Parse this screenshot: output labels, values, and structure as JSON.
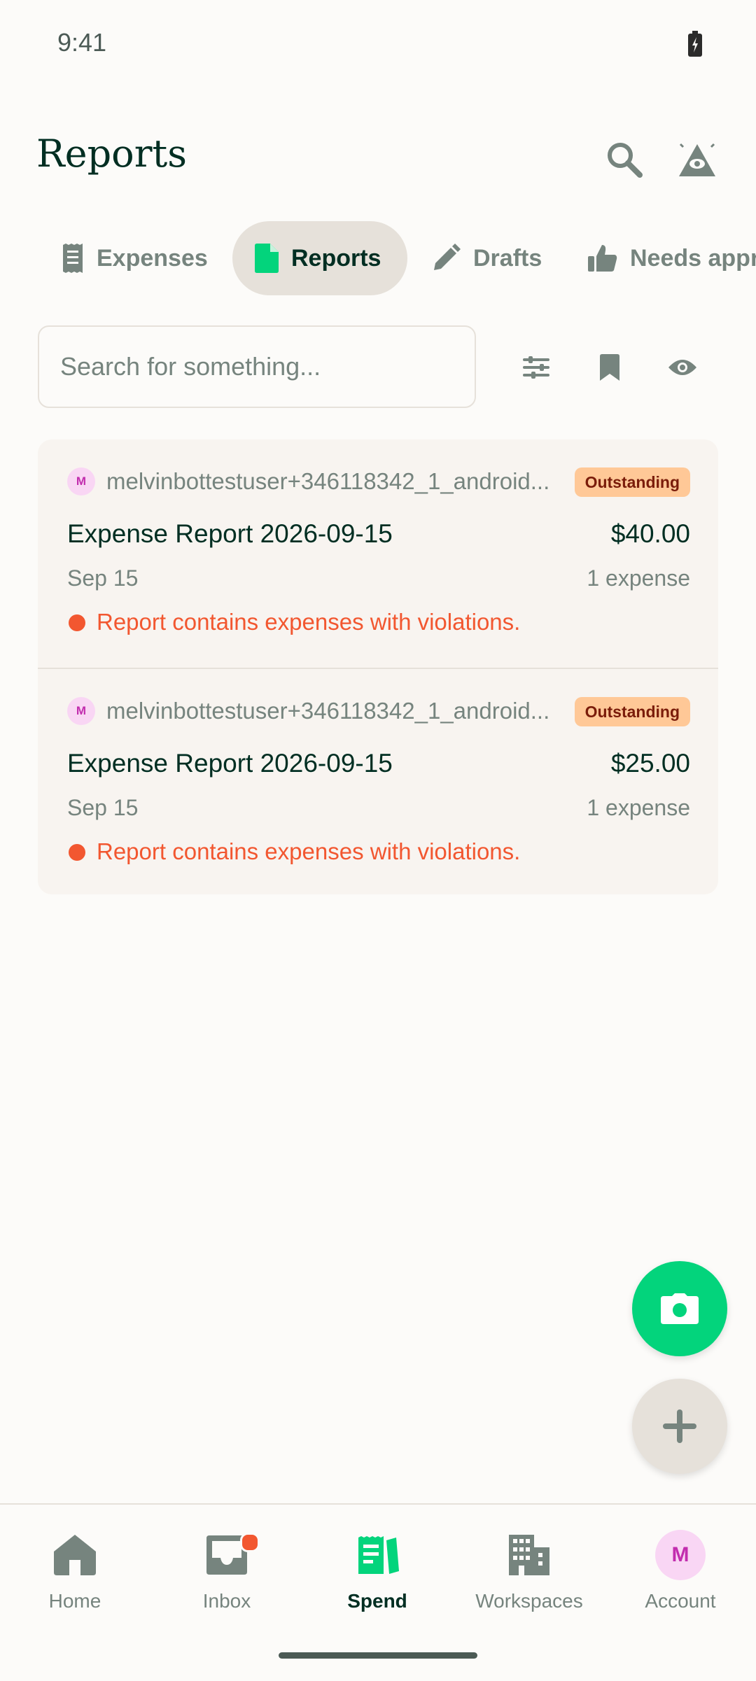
{
  "status_bar": {
    "time": "9:41"
  },
  "header": {
    "title": "Reports"
  },
  "tabs": [
    {
      "label": "Expenses",
      "icon": "receipt-icon",
      "active": false
    },
    {
      "label": "Reports",
      "icon": "document-icon",
      "active": true
    },
    {
      "label": "Drafts",
      "icon": "pencil-icon",
      "active": false
    },
    {
      "label": "Needs appr",
      "icon": "thumbs-up-icon",
      "active": false
    }
  ],
  "search": {
    "placeholder": "Search for something..."
  },
  "reports": [
    {
      "avatar_initial": "M",
      "submitter": "melvinbottestuser+346118342_1_android...",
      "status": "Outstanding",
      "title": "Expense Report 2026-09-15",
      "amount": "$40.00",
      "date": "Sep 15",
      "expense_count": "1 expense",
      "violation": "Report contains expenses with violations."
    },
    {
      "avatar_initial": "M",
      "submitter": "melvinbottestuser+346118342_1_android...",
      "status": "Outstanding",
      "title": "Expense Report 2026-09-15",
      "amount": "$25.00",
      "date": "Sep 15",
      "expense_count": "1 expense",
      "violation": "Report contains expenses with violations."
    }
  ],
  "bottom_nav": [
    {
      "label": "Home",
      "icon": "home-icon",
      "active": false
    },
    {
      "label": "Inbox",
      "icon": "inbox-icon",
      "active": false
    },
    {
      "label": "Spend",
      "icon": "spend-icon",
      "active": true
    },
    {
      "label": "Workspaces",
      "icon": "building-icon",
      "active": false
    },
    {
      "label": "Account",
      "icon": "avatar",
      "active": false,
      "avatar_initial": "M"
    }
  ],
  "colors": {
    "background": "#FCFBF9",
    "accent_green": "#03D47C",
    "text_dark": "#002E22",
    "text_muted": "#76847E",
    "danger": "#F25730",
    "badge_bg": "#FFC897",
    "card_bg": "#F8F4F0"
  }
}
